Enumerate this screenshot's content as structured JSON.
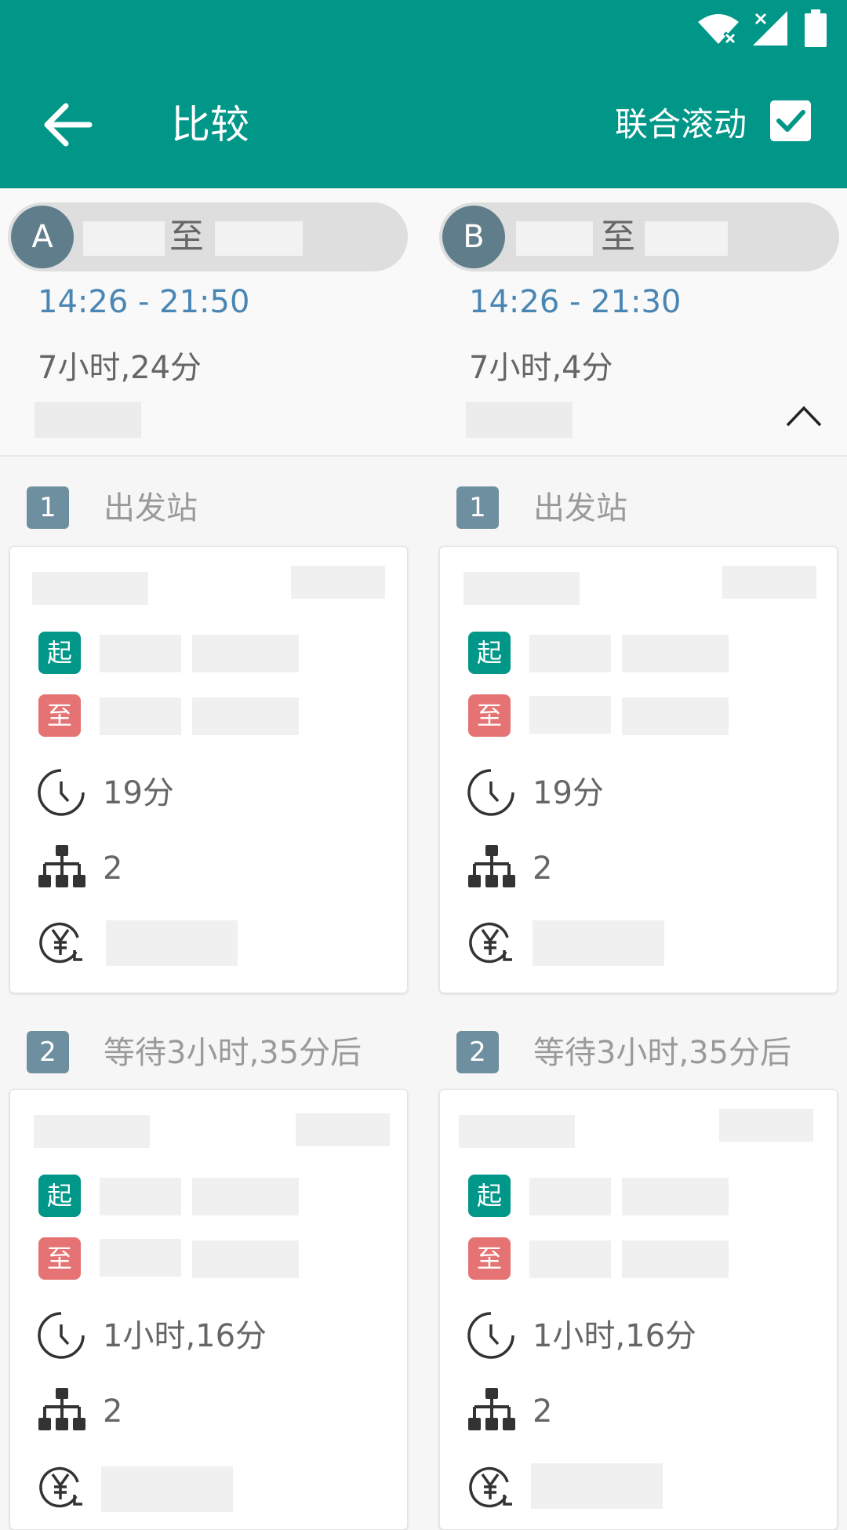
{
  "toolbar": {
    "title": "比较",
    "sync_scroll_label": "联合滚动",
    "sync_checked": true
  },
  "colors": {
    "primary": "#009688",
    "time_blue": "#4a86b4",
    "start_tag": "#009688",
    "end_tag": "#e57373"
  },
  "routes": [
    {
      "badge": "A",
      "to": "至",
      "time": "14:26 - 21:50",
      "duration": "7小时,24分"
    },
    {
      "badge": "B",
      "to": "至",
      "time": "14:26 - 21:30",
      "duration": "7小时,4分"
    }
  ],
  "icons": [
    "back-arrow-icon",
    "checkbox-icon",
    "wifi-icon",
    "signal-icon",
    "battery-icon",
    "chevron-up-icon",
    "clock-icon",
    "transfer-tree-icon",
    "yen-refund-icon"
  ],
  "columns": [
    {
      "steps": [
        {
          "num": "1",
          "label": "出发站",
          "start_tag": "起",
          "end_tag": "至",
          "duration": "19分",
          "stops": "2"
        },
        {
          "num": "2",
          "label": "等待3小时,35分后",
          "start_tag": "起",
          "end_tag": "至",
          "duration": "1小时,16分",
          "stops": "2"
        }
      ]
    },
    {
      "steps": [
        {
          "num": "1",
          "label": "出发站",
          "start_tag": "起",
          "end_tag": "至",
          "duration": "19分",
          "stops": "2"
        },
        {
          "num": "2",
          "label": "等待3小时,35分后",
          "start_tag": "起",
          "end_tag": "至",
          "duration": "1小时,16分",
          "stops": "2"
        }
      ]
    }
  ]
}
